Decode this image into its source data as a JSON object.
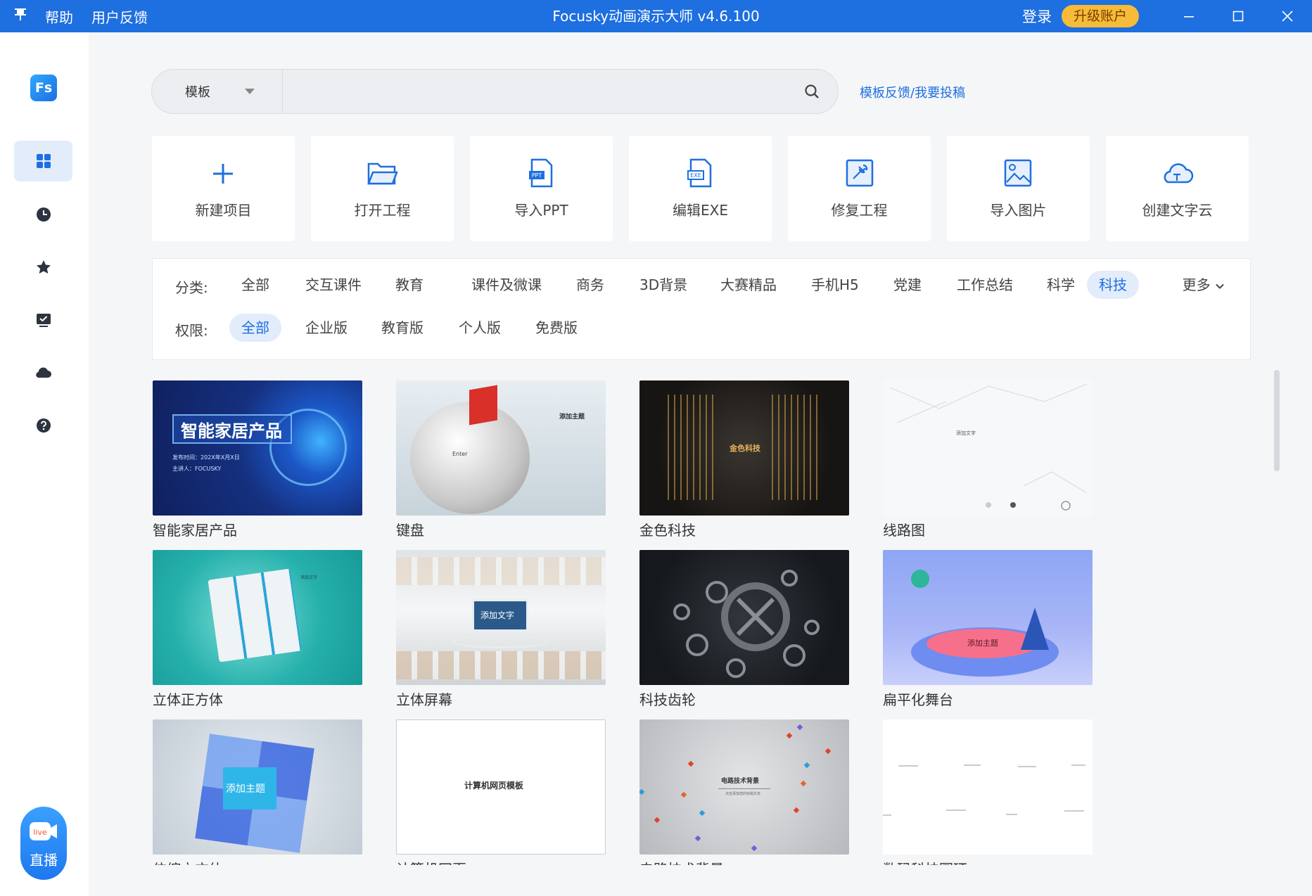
{
  "titlebar": {
    "pin_icon": "pin-icon",
    "help": "帮助",
    "feedback": "用户反馈",
    "title": "Focusky动画演示大师 v4.6.100",
    "login": "登录",
    "upgrade": "升级账户"
  },
  "sidebar": {
    "logo": "Fs",
    "items": [
      {
        "icon": "grid-icon",
        "active": true
      },
      {
        "icon": "clock-icon"
      },
      {
        "icon": "star-icon"
      },
      {
        "icon": "monitor-check-icon"
      },
      {
        "icon": "cloud-icon"
      },
      {
        "icon": "help-icon"
      }
    ],
    "live_label": "直播",
    "live_icon_text": "live"
  },
  "search": {
    "type": "模板",
    "placeholder": "",
    "feedback_link": "模板反馈/我要投稿"
  },
  "actions": [
    {
      "label": "新建项目",
      "icon": "plus-icon"
    },
    {
      "label": "打开工程",
      "icon": "folder-icon"
    },
    {
      "label": "导入PPT",
      "icon": "ppt-file-icon",
      "badge": "PPT"
    },
    {
      "label": "编辑EXE",
      "icon": "exe-file-icon",
      "badge": "EXE"
    },
    {
      "label": "修复工程",
      "icon": "repair-tools-icon"
    },
    {
      "label": "导入图片",
      "icon": "image-icon"
    },
    {
      "label": "创建文字云",
      "icon": "word-cloud-icon"
    }
  ],
  "filters": {
    "category_label": "分类:",
    "categories": [
      "全部",
      "交互课件",
      "教育",
      "课件及微课",
      "商务",
      "3D背景",
      "大赛精品",
      "手机H5",
      "党建",
      "工作总结",
      "科学",
      "科技"
    ],
    "selected_category": "科技",
    "more": "更多",
    "permission_label": "权限:",
    "permissions": [
      "全部",
      "企业版",
      "教育版",
      "个人版",
      "免费版"
    ],
    "selected_permission": "全部"
  },
  "templates": [
    {
      "name": "智能家居产品",
      "thumb_title": "智能家居产品",
      "thumb_lines": [
        "发布时间：202X年X月X日",
        "主讲人：FOCUSKY"
      ]
    },
    {
      "name": "键盘",
      "thumb_title": "添加主题",
      "thumb_key": "Enter"
    },
    {
      "name": "金色科技",
      "thumb_title": "金色科技"
    },
    {
      "name": "线路图",
      "thumb_title": "添加文字"
    },
    {
      "name": "立体正方体",
      "thumb_title": "添加文字"
    },
    {
      "name": "立体屏幕",
      "thumb_title": "添加文字"
    },
    {
      "name": "科技齿轮",
      "thumb_title": ""
    },
    {
      "name": "扁平化舞台",
      "thumb_title": "添加主题"
    },
    {
      "name": "伸缩立方体",
      "thumb_title": "添加主题"
    },
    {
      "name": "计算机网页",
      "thumb_title": "计算机网页模板"
    },
    {
      "name": "电路技术背景",
      "thumb_title": "电路技术背景",
      "thumb_sub": "点击添加您的标题文本"
    },
    {
      "name": "数码科技圆环",
      "thumb_title": ""
    }
  ],
  "colors": {
    "brand": "#1e6fe0",
    "upgrade": "#f6bb38",
    "selected_chip_bg": "#e3ecfb"
  }
}
